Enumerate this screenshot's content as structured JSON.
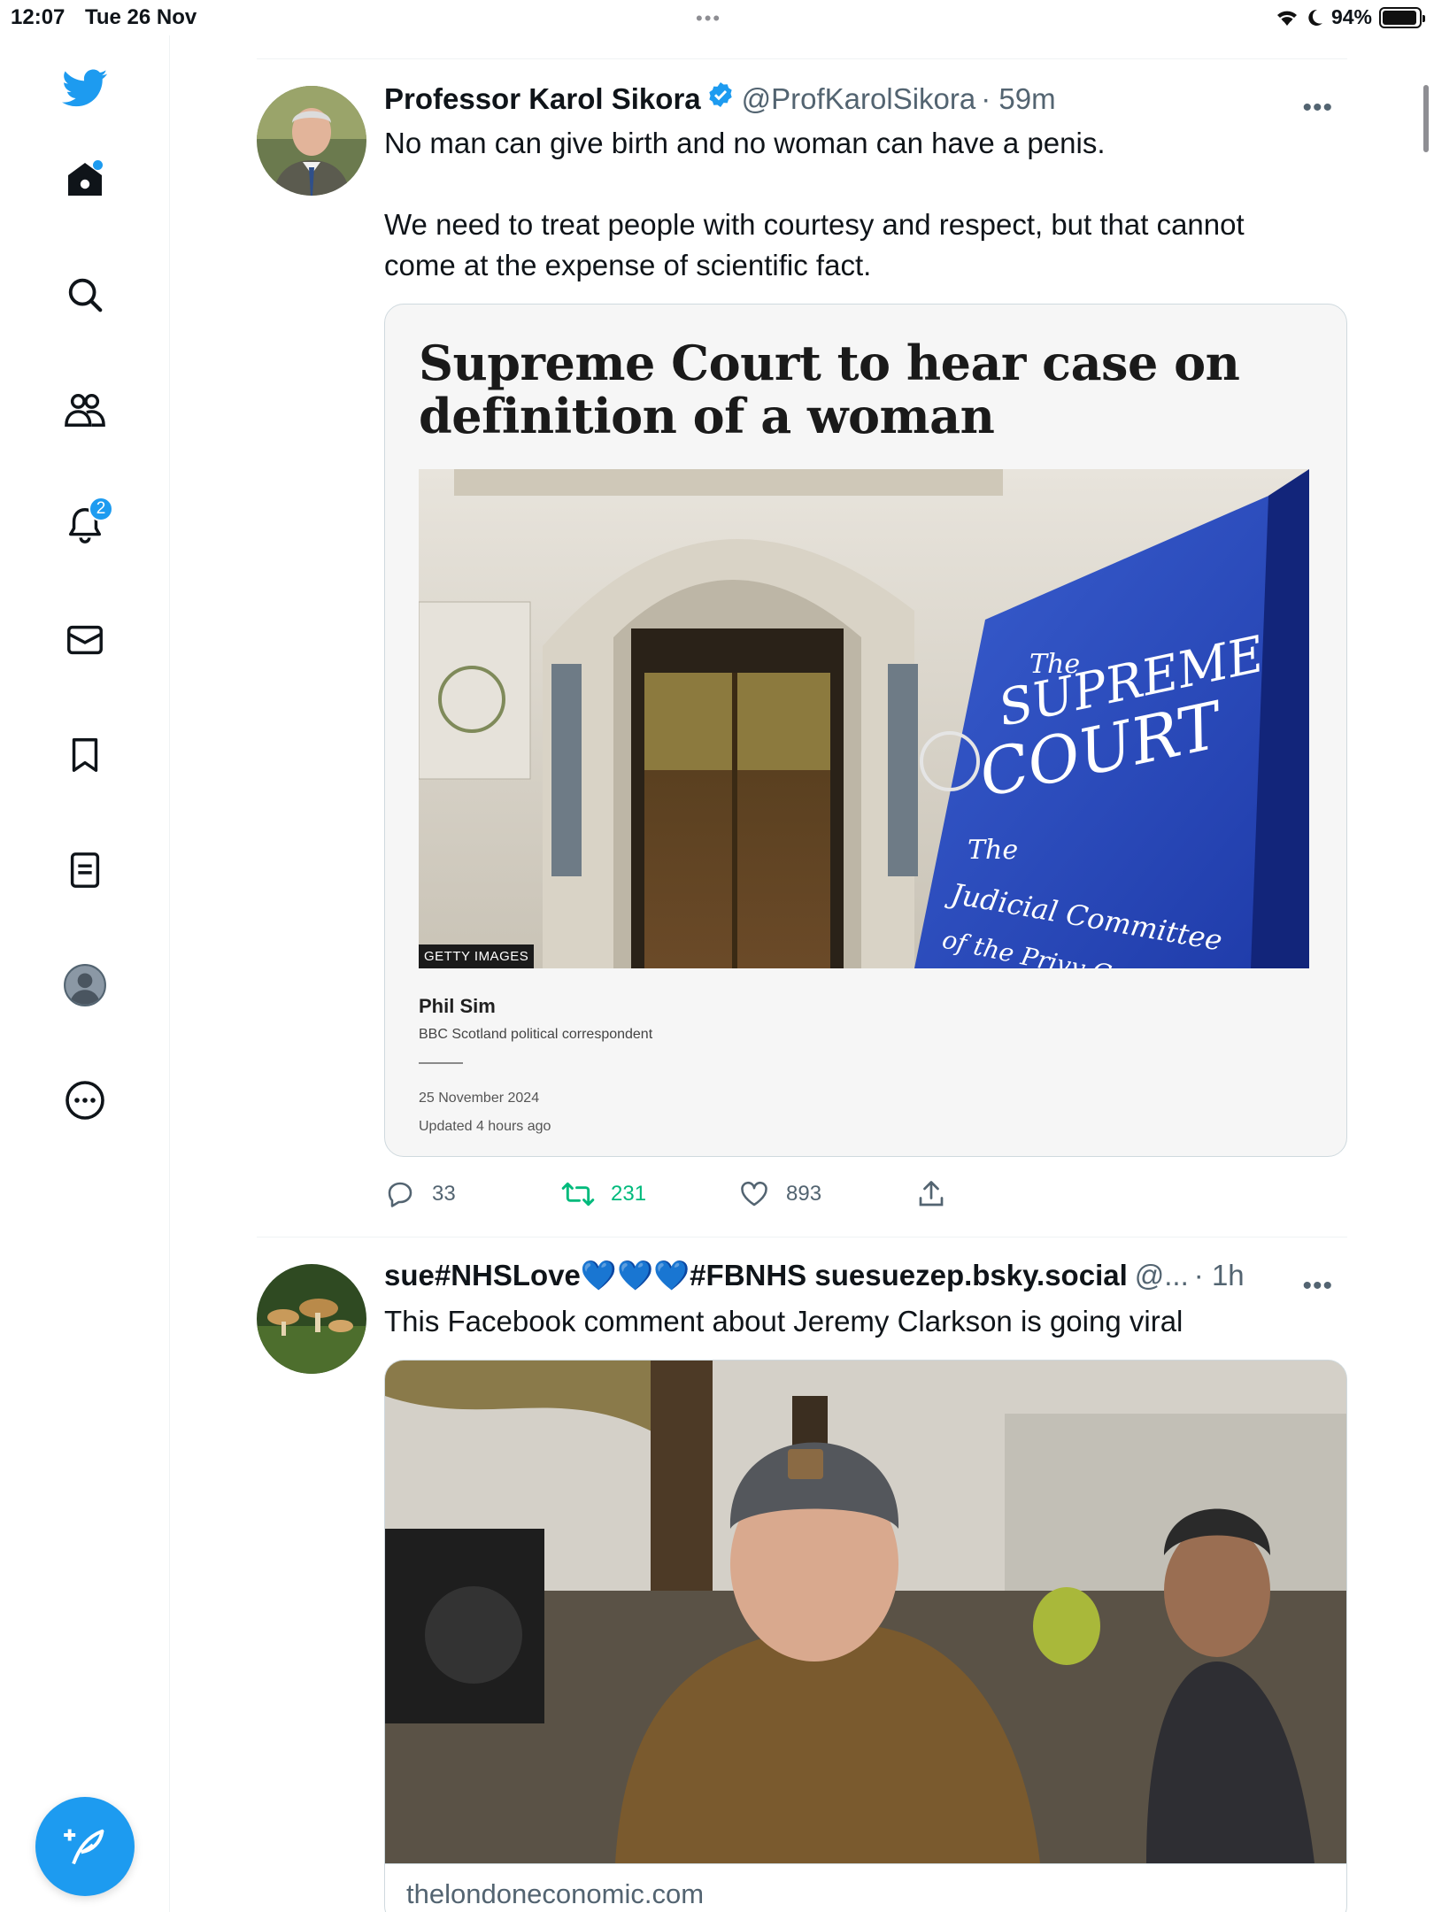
{
  "status_bar": {
    "time": "12:07",
    "date": "Tue 26 Nov",
    "battery": "94%",
    "battery_level": 0.94
  },
  "sidebar": {
    "notifications_badge": "2",
    "items": [
      "home-icon",
      "search-icon",
      "communities-icon",
      "notifications-icon",
      "messages-icon",
      "bookmarks-icon",
      "lists-icon",
      "profile-icon",
      "more-icon"
    ]
  },
  "colors": {
    "accent": "#1d9bf0",
    "retweet": "#00ba7c",
    "secondary_text": "#536471"
  },
  "tweets": [
    {
      "name": "Professor Karol Sikora",
      "handle": "@ProfKarolSikora",
      "time": "· 59m",
      "text": "No man can give birth and no woman can have a penis.\n\nWe need to treat people with courtesy and respect, but that cannot come at the expense of scientific fact.",
      "card": {
        "headline": "Supreme Court to hear case on definition of a woman",
        "photo_credit": "GETTY IMAGES",
        "author": "Phil Sim",
        "author_role": "BBC Scotland political correspondent",
        "date": "25 November 2024",
        "updated": "Updated 4 hours ago",
        "sign_lines": [
          "The",
          "SUPREME",
          "COURT",
          "The",
          "Judicial Committee",
          "of the Privy C"
        ]
      },
      "replies": "33",
      "retweets": "231",
      "likes": "893"
    },
    {
      "name": "sue#NHSLove💙💙💙#FBNHS suesuezep.bsky.social",
      "handle": "@...",
      "time": "· 1h",
      "text": "This Facebook comment about Jeremy Clarkson is going viral",
      "card": {
        "domain": "thelondoneconomic.com"
      }
    }
  ]
}
